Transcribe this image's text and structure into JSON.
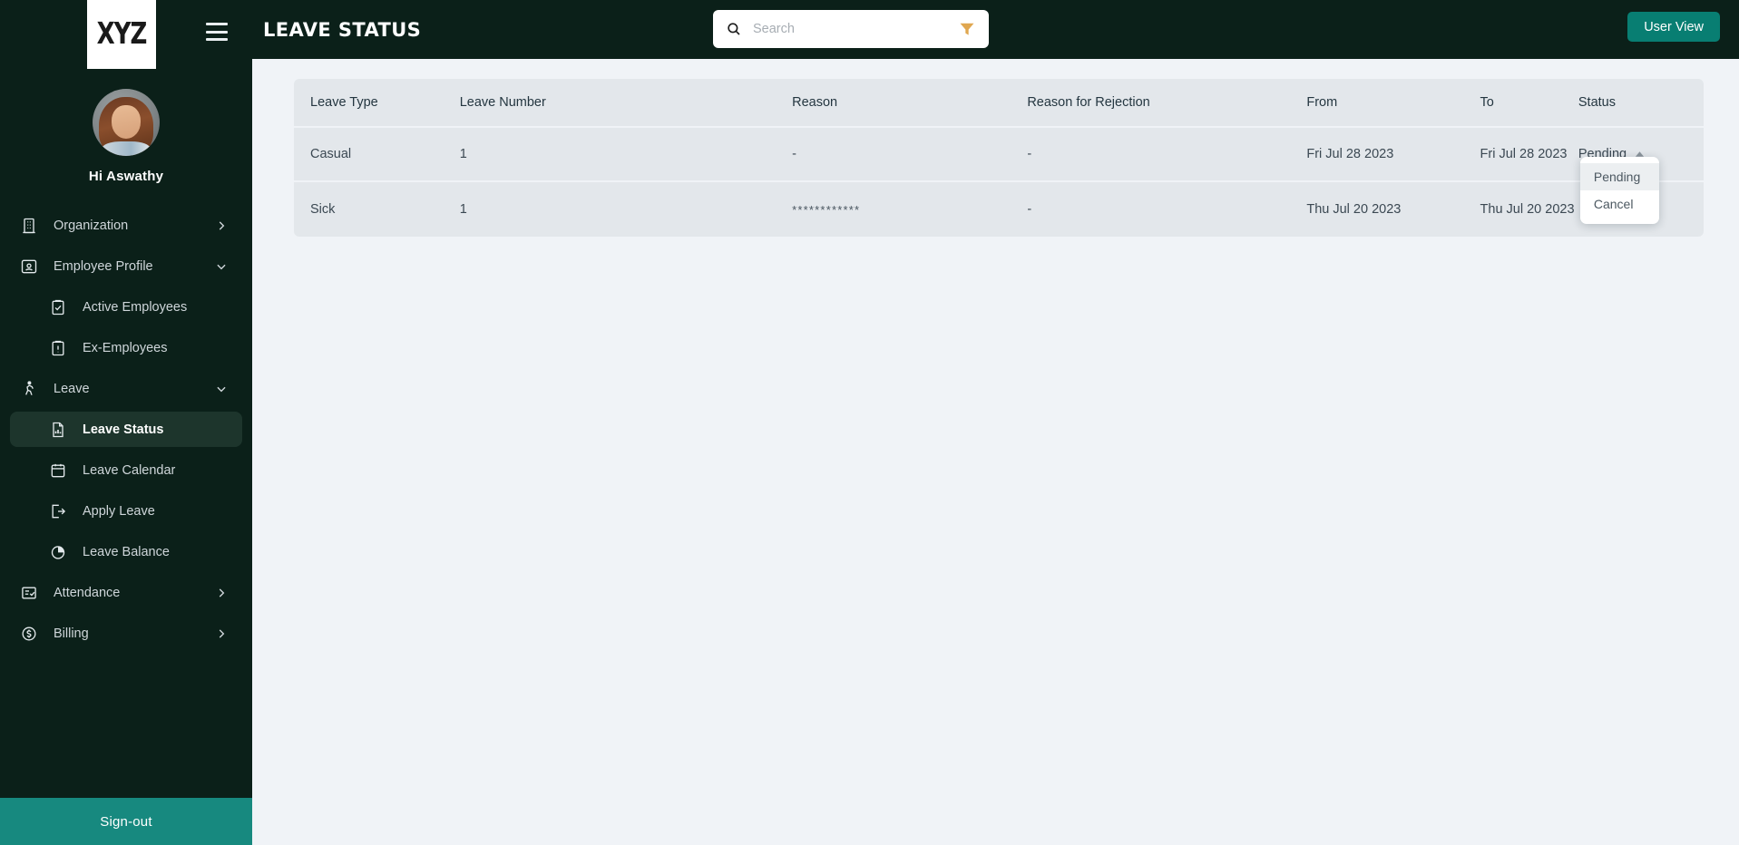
{
  "sidebar": {
    "logo_text": "XYZ",
    "menu_icon": "hamburger-icon",
    "greeting": "Hi Aswathy",
    "items": [
      {
        "label": "Organization",
        "icon": "building-icon",
        "level": "top",
        "expandable": true,
        "expanded": false,
        "active": false
      },
      {
        "label": "Employee Profile",
        "icon": "id-card-icon",
        "level": "top",
        "expandable": true,
        "expanded": true,
        "active": false
      },
      {
        "label": "Active Employees",
        "icon": "clipboard-check-icon",
        "level": "sub",
        "expandable": false,
        "expanded": false,
        "active": false
      },
      {
        "label": "Ex-Employees",
        "icon": "clipboard-alert-icon",
        "level": "sub",
        "expandable": false,
        "expanded": false,
        "active": false
      },
      {
        "label": "Leave",
        "icon": "walking-person-icon",
        "level": "top",
        "expandable": true,
        "expanded": true,
        "active": false
      },
      {
        "label": "Leave Status",
        "icon": "document-chart-icon",
        "level": "sub",
        "expandable": false,
        "expanded": false,
        "active": true
      },
      {
        "label": "Leave Calendar",
        "icon": "calendar-icon",
        "level": "sub",
        "expandable": false,
        "expanded": false,
        "active": false
      },
      {
        "label": "Apply Leave",
        "icon": "logout-arrow-icon",
        "level": "sub",
        "expandable": false,
        "expanded": false,
        "active": false
      },
      {
        "label": "Leave Balance",
        "icon": "pie-chart-icon",
        "level": "sub",
        "expandable": false,
        "expanded": false,
        "active": false
      },
      {
        "label": "Attendance",
        "icon": "checklist-icon",
        "level": "top",
        "expandable": true,
        "expanded": false,
        "active": false
      },
      {
        "label": "Billing",
        "icon": "dollar-circle-icon",
        "level": "top",
        "expandable": true,
        "expanded": false,
        "active": false
      }
    ],
    "signout_label": "Sign-out"
  },
  "topbar": {
    "title": "LEAVE STATUS",
    "search_placeholder": "Search",
    "search_value": "",
    "search_icon": "magnifier-icon",
    "filter_icon": "funnel-icon",
    "filter_icon_color": "#e0a750",
    "user_view_label": "User View",
    "user_view_color": "#087e72"
  },
  "table": {
    "columns": [
      "Leave Type",
      "Leave Number",
      "Reason",
      "Reason for Rejection",
      "From",
      "To",
      "Status"
    ],
    "rows": [
      {
        "leave_type": "Casual",
        "leave_number": "1",
        "reason": "-",
        "reason_for_rejection": "-",
        "from": "Fri Jul 28 2023",
        "to": "Fri Jul 28 2023",
        "status": "Pending"
      },
      {
        "leave_type": "Sick",
        "leave_number": "1",
        "reason": "************",
        "reason_for_rejection": "-",
        "from": "Thu Jul 20 2023",
        "to": "Thu Jul 20 2023",
        "status": ""
      }
    ]
  },
  "status_dropdown": {
    "open": true,
    "caret_icon": "caret-up-icon",
    "options": [
      {
        "label": "Pending",
        "hovered": true
      },
      {
        "label": "Cancel",
        "hovered": false
      }
    ]
  },
  "colors": {
    "sidebar_bg": "#0b2019",
    "page_bg": "#f0f3f7",
    "table_bg": "#e3e7eb",
    "accent_teal": "#17897f",
    "active_item_bg": "#1d352c"
  }
}
